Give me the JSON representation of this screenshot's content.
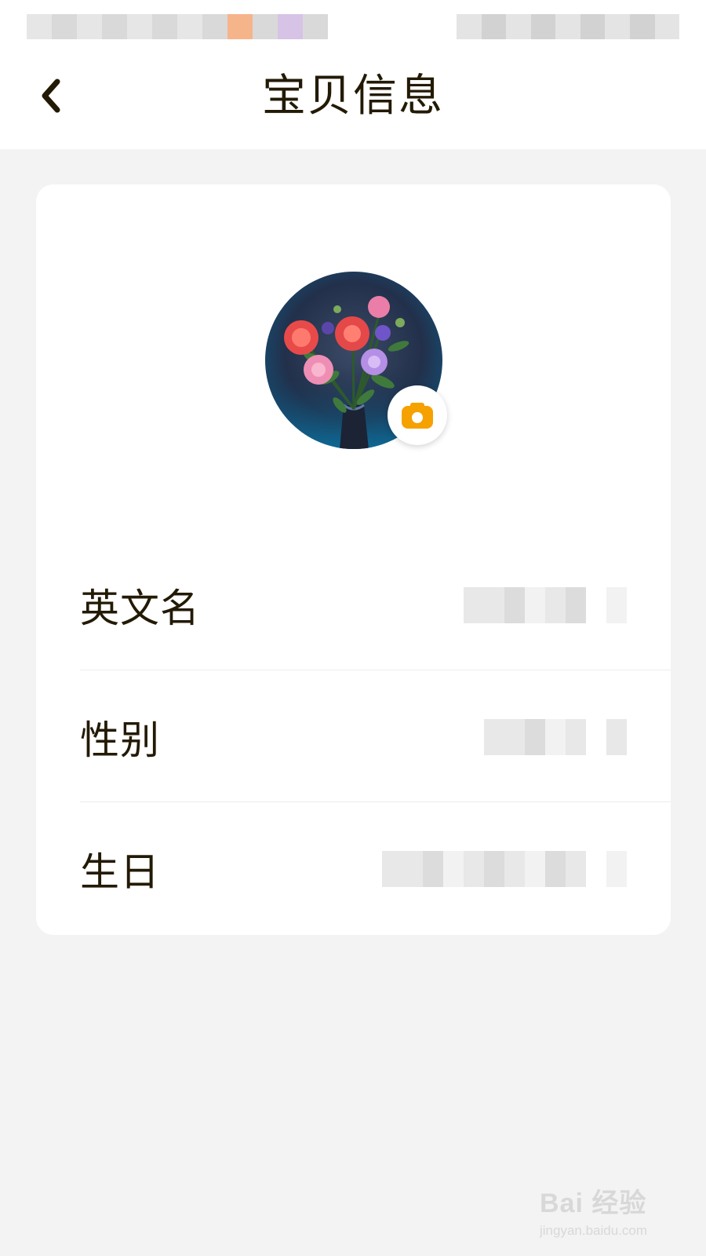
{
  "header": {
    "title": "宝贝信息",
    "back_icon": "chevron-left-icon"
  },
  "profile": {
    "avatar_alt": "flowers-in-vase",
    "camera_icon": "camera-icon",
    "accent_color": "#f5a100"
  },
  "fields": [
    {
      "label": "英文名",
      "value": ""
    },
    {
      "label": "性别",
      "value": ""
    },
    {
      "label": "生日",
      "value": ""
    }
  ],
  "watermark": {
    "main": "Bai 经验",
    "sub": "jingyan.baidu.com"
  },
  "colors": {
    "background": "#f3f3f3",
    "card": "#ffffff",
    "text": "#231a05"
  }
}
